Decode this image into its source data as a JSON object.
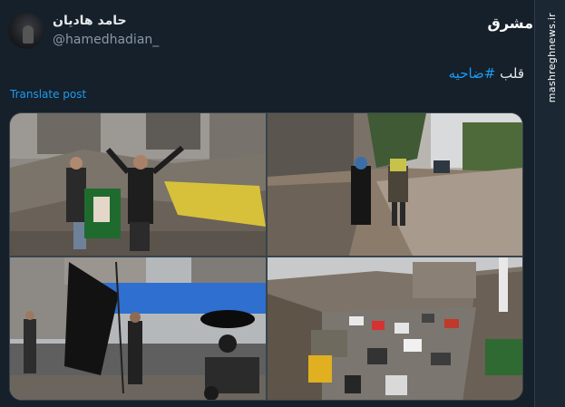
{
  "author": {
    "name": "حامد هادیان",
    "handle": "@hamedhadian_"
  },
  "logo": {
    "text": "مشرق"
  },
  "watermark": {
    "text": "mashreghnews.ir"
  },
  "tweet": {
    "prefix": "قلب ",
    "hashtag": "#ضاحیه",
    "translate_label": "Translate post"
  },
  "media": {
    "images": [
      {
        "icon": "rubble-photo"
      },
      {
        "icon": "street-photo"
      },
      {
        "icon": "flag-bridge-photo"
      },
      {
        "icon": "traffic-photo"
      }
    ]
  },
  "colors": {
    "background": "#15202b",
    "link": "#1d9bf0",
    "text": "#e7e9ea",
    "secondary": "#8b98a5"
  }
}
